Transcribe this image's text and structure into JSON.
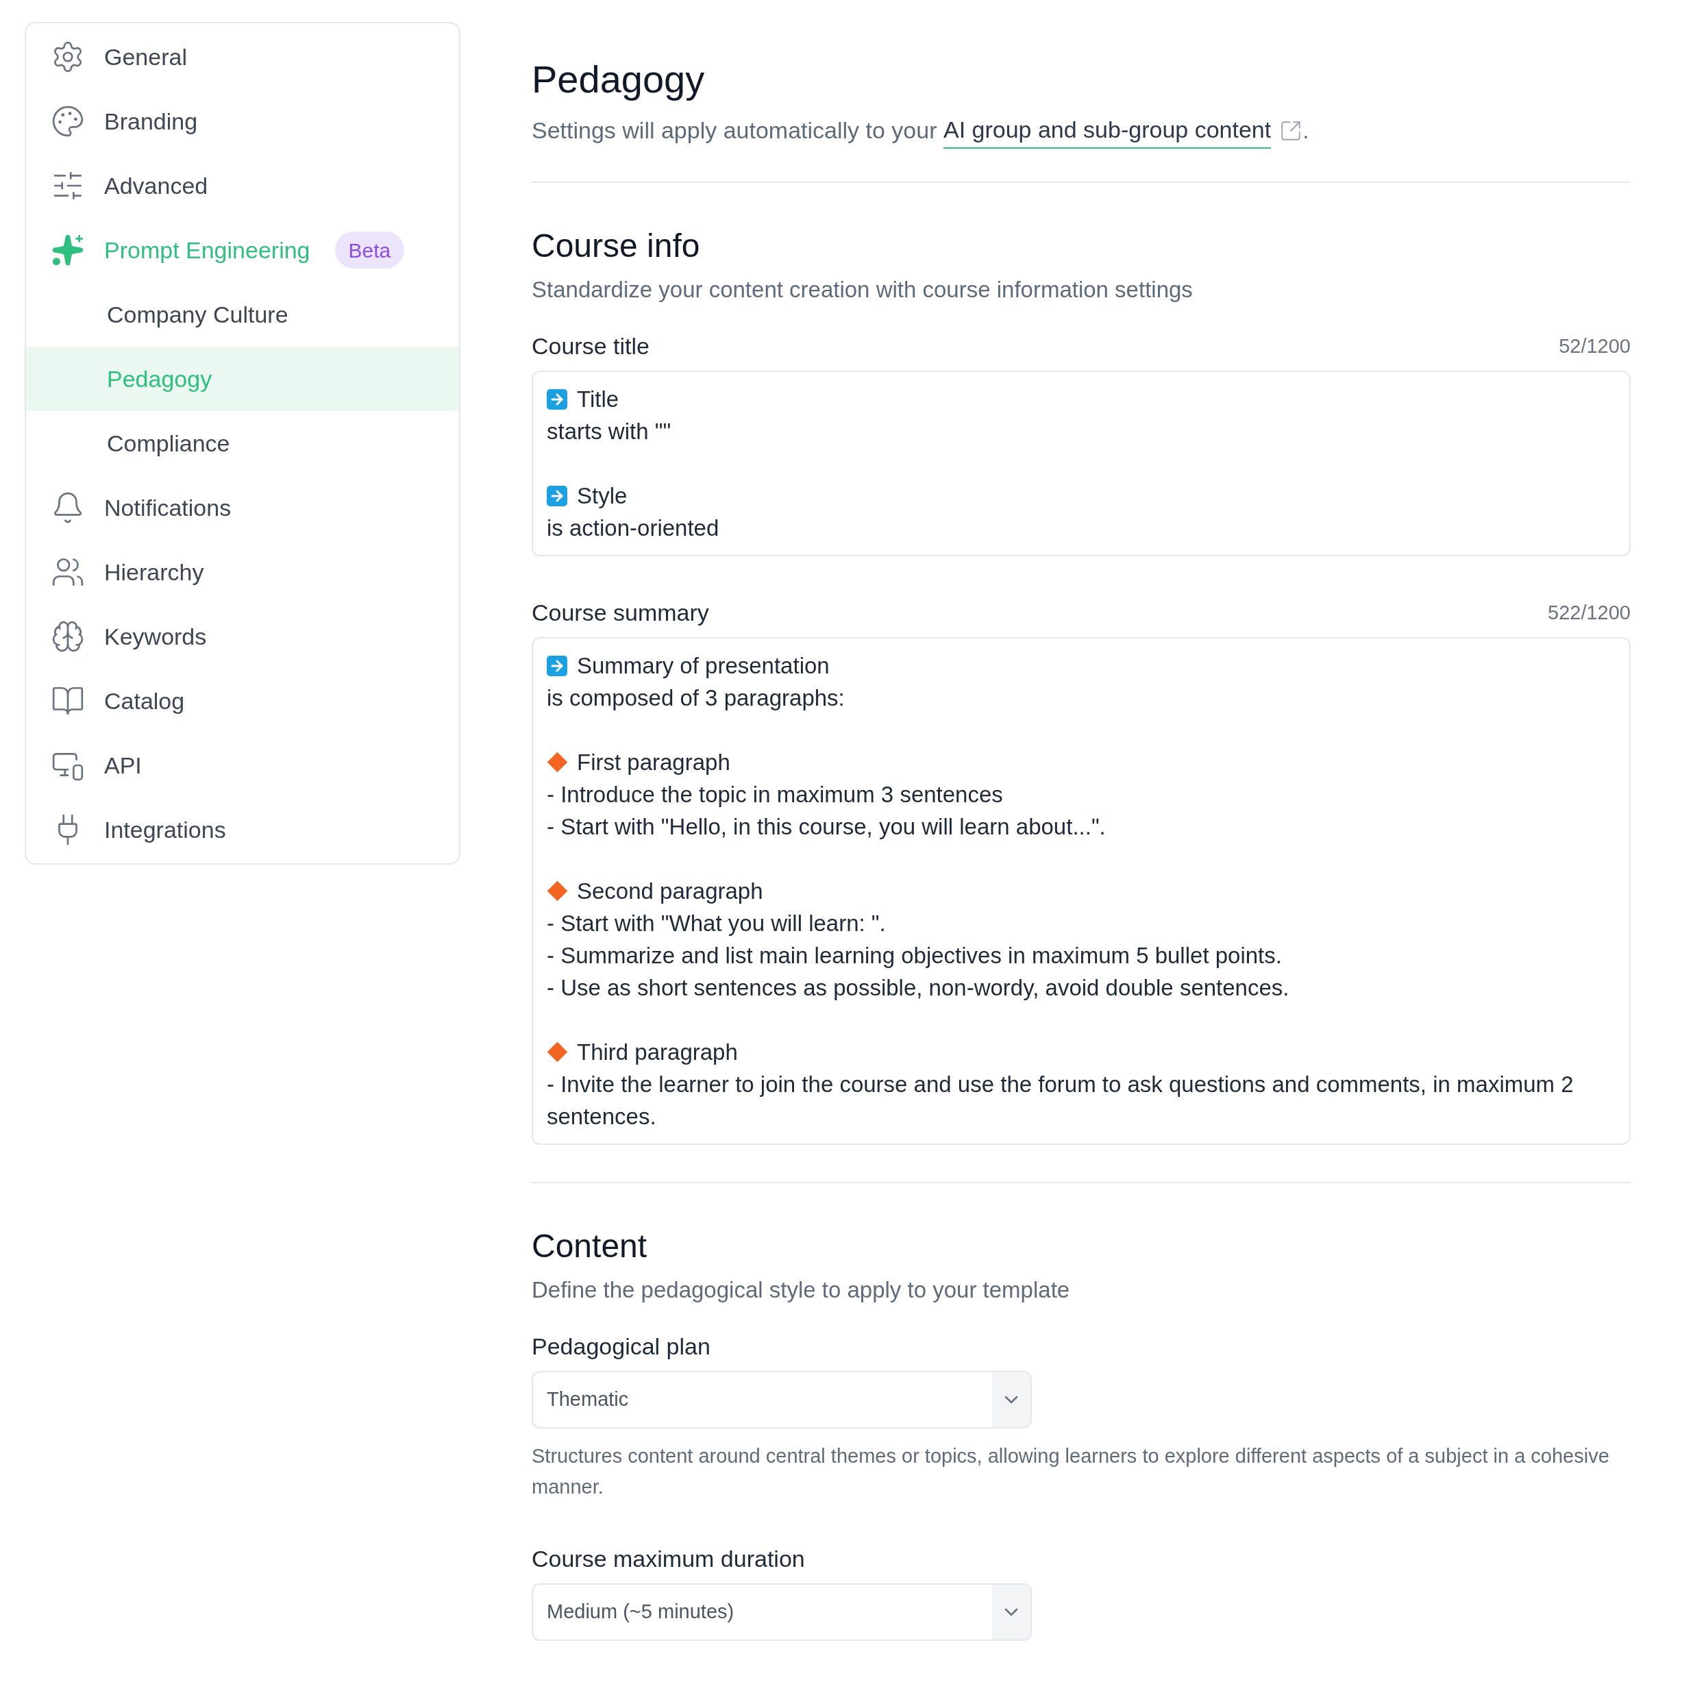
{
  "sidebar": {
    "items": [
      {
        "label": "General",
        "expanded": false
      },
      {
        "label": "Branding",
        "expanded": false
      },
      {
        "label": "Advanced",
        "expanded": false
      },
      {
        "label": "Prompt Engineering",
        "expanded": true,
        "badge": "Beta",
        "children": [
          {
            "label": "Company Culture",
            "selected": false
          },
          {
            "label": "Pedagogy",
            "selected": true
          },
          {
            "label": "Compliance",
            "selected": false
          }
        ]
      },
      {
        "label": "Notifications",
        "expanded": false
      },
      {
        "label": "Hierarchy",
        "expanded": false
      },
      {
        "label": "Keywords",
        "expanded": false
      },
      {
        "label": "Catalog",
        "expanded": false
      },
      {
        "label": "API",
        "expanded": false
      },
      {
        "label": "Integrations",
        "expanded": false
      }
    ]
  },
  "page": {
    "title": "Pedagogy",
    "subtitle": {
      "text": "Settings will apply automatically to your ",
      "link": "AI group and sub-group content",
      "end": "."
    }
  },
  "sections": [
    {
      "title": "Course info",
      "description": "Standardize your content creation with course information settings",
      "fields": [
        {
          "kind": "textarea",
          "label": "Course title",
          "counter": "52/1200",
          "blocks": [
            {
              "kind": "arrow",
              "heading": "Title",
              "lines": [
                "starts with \"\""
              ]
            },
            {
              "kind": "arrow",
              "heading": "Style",
              "lines": [
                "is action-oriented"
              ]
            }
          ]
        },
        {
          "kind": "textarea",
          "label": "Course summary",
          "counter": "522/1200",
          "blocks": [
            {
              "kind": "arrow",
              "heading": "Summary of presentation",
              "lines": [
                "is composed of 3 paragraphs:"
              ]
            },
            {
              "kind": "diamond",
              "heading": "First paragraph",
              "lines": [
                "- Introduce the topic in maximum 3 sentences",
                "- Start with \"Hello, in this course, you will learn about...\"."
              ]
            },
            {
              "kind": "diamond",
              "heading": "Second paragraph",
              "lines": [
                "- Start with \"What you will learn: \".",
                "- Summarize and list main learning objectives in maximum 5 bullet points.",
                "- Use as short sentences as possible, non-wordy, avoid double sentences."
              ]
            },
            {
              "kind": "diamond",
              "heading": "Third paragraph",
              "lines": [
                "- Invite the learner to join the course and use the forum to ask questions and comments, in maximum 2 sentences."
              ]
            }
          ]
        }
      ]
    },
    {
      "title": "Content",
      "description": "Define the pedagogical style to apply to your template",
      "fields": [
        {
          "kind": "select",
          "label": "Pedagogical plan",
          "value": "Thematic",
          "help": "Structures content around central themes or topics, allowing learners to explore different aspects of a subject in a cohesive manner."
        },
        {
          "kind": "select",
          "label": "Course maximum duration",
          "value": "Medium (~5 minutes)"
        }
      ]
    }
  ]
}
